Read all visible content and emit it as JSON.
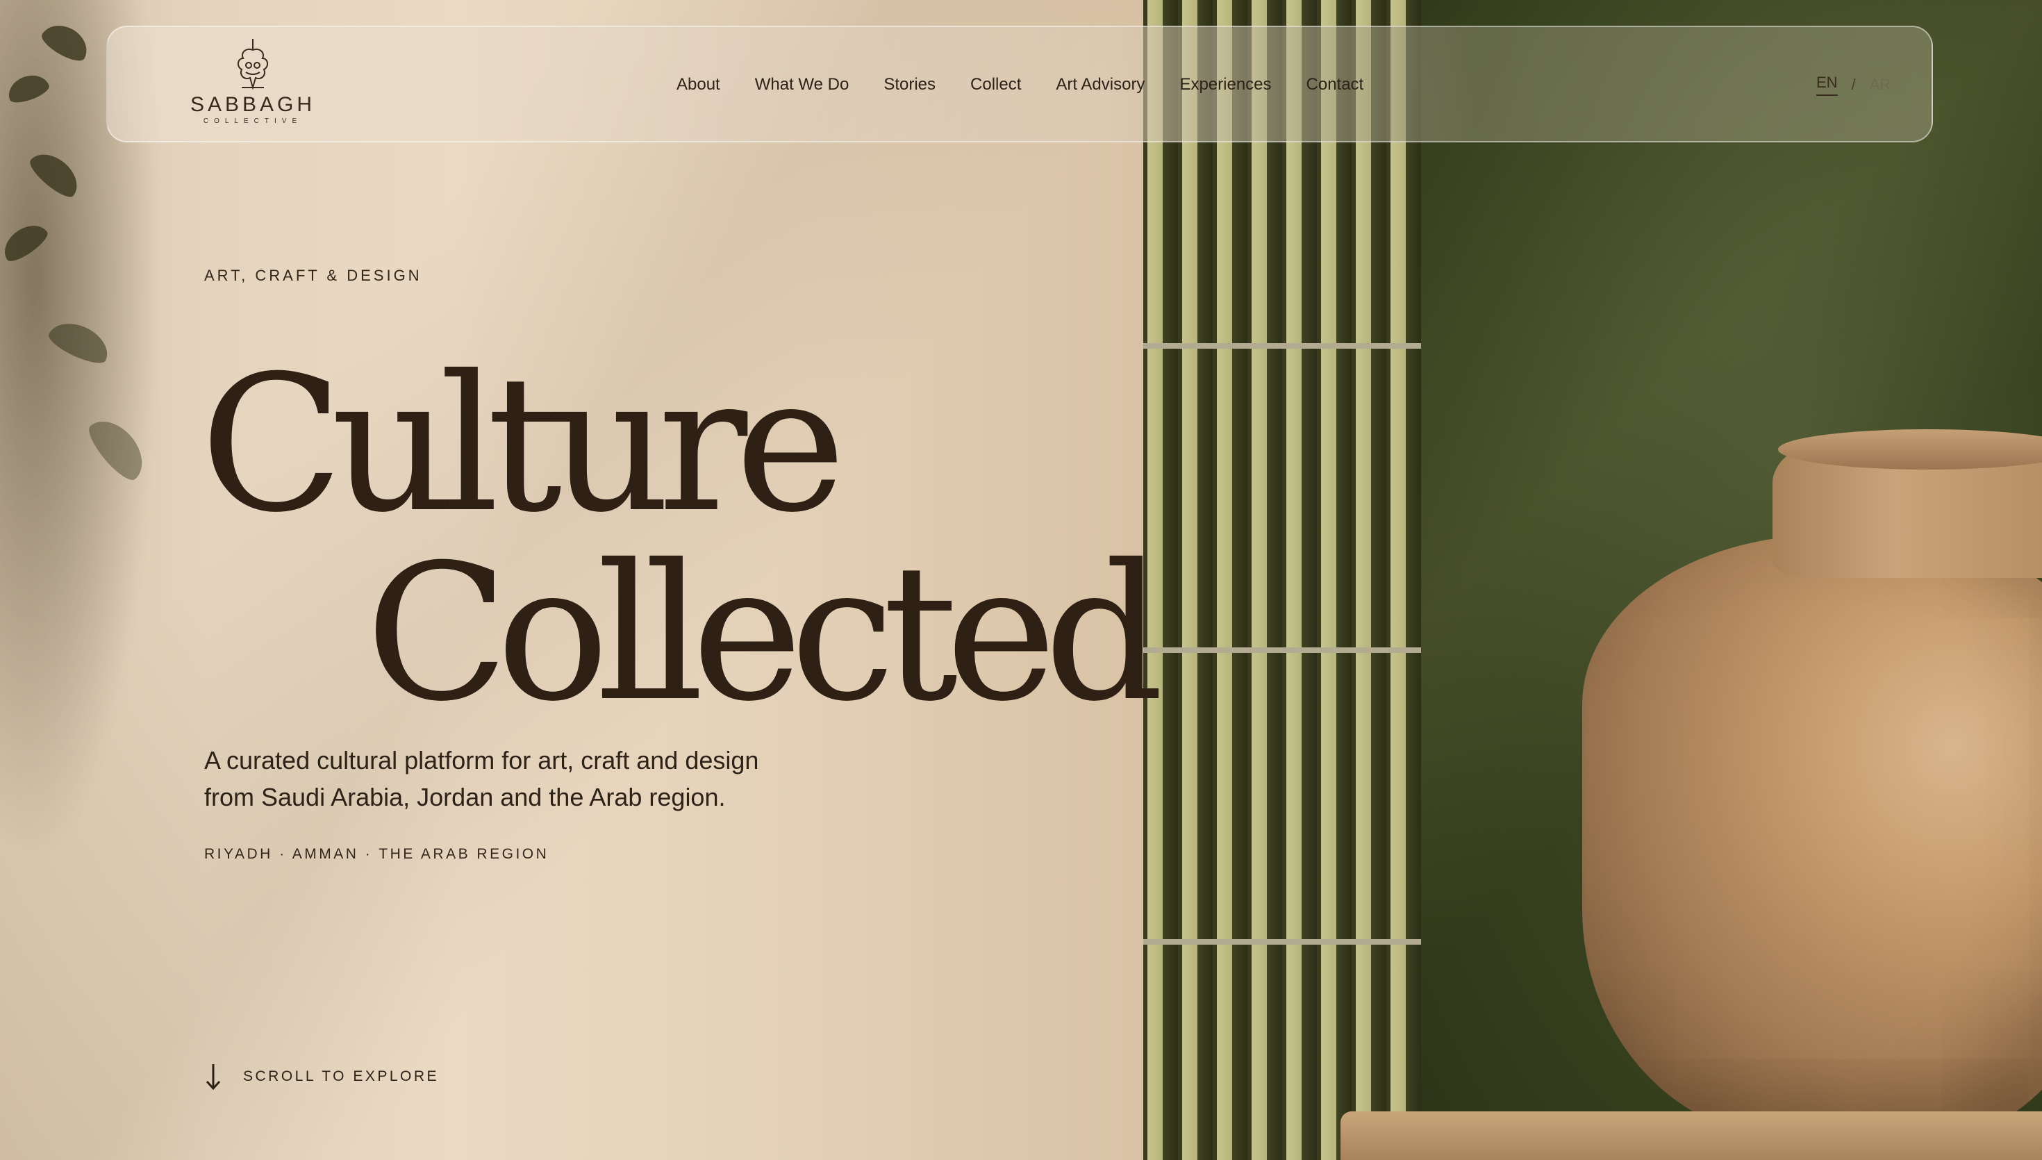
{
  "brand": {
    "name": "SABBAGH",
    "subtitle": "COLLECTIVE"
  },
  "nav": {
    "items": [
      {
        "label": "About"
      },
      {
        "label": "What We Do"
      },
      {
        "label": "Stories"
      },
      {
        "label": "Collect"
      },
      {
        "label": "Art Advisory"
      },
      {
        "label": "Experiences"
      },
      {
        "label": "Contact"
      }
    ]
  },
  "language": {
    "en": "EN",
    "separator": "/",
    "ar": "AR",
    "active": "EN"
  },
  "hero": {
    "eyebrow": "ART, CRAFT & DESIGN",
    "title_line1": "Culture",
    "title_line2": "Collected",
    "tagline_line1": "A curated cultural platform for art, craft and design",
    "tagline_line2": "from Saudi Arabia, Jordan and the Arab region.",
    "locations": "RIYADH · AMMAN · THE ARAB REGION"
  },
  "scroll": {
    "label": "SCROLL TO EXPLORE",
    "icon": "arrow-down-icon"
  },
  "colors": {
    "text_dark": "#2f2015",
    "wall_beige": "#e6d8c3",
    "wall_green": "#38421f",
    "tile_light": "#c6c48e"
  }
}
